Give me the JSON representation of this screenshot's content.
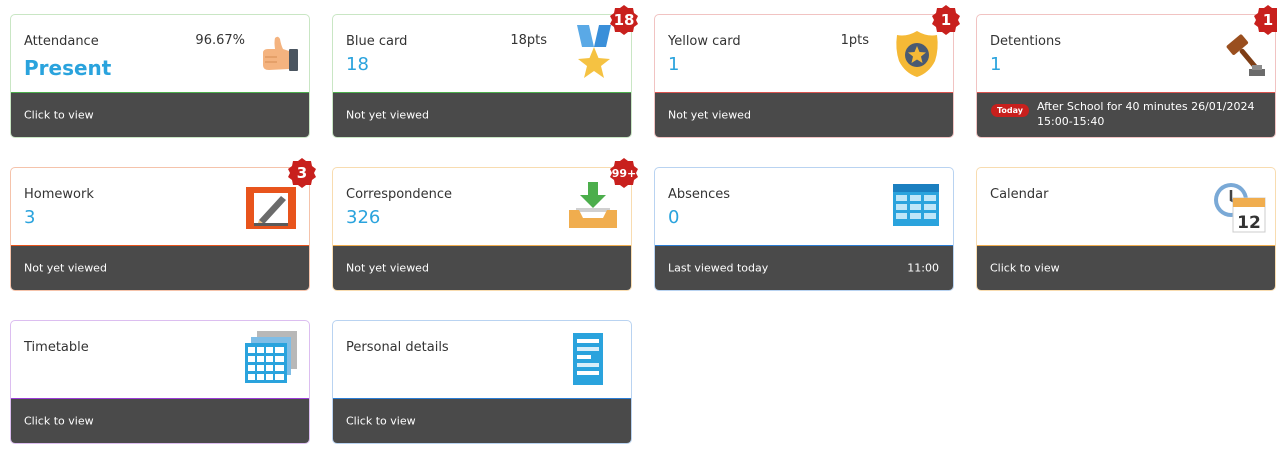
{
  "colors": {
    "bar_dark": "#4a4a4a",
    "stat_blue": "#2aa3dd",
    "badge_red": "#c8201d"
  },
  "tiles": {
    "attendance": {
      "title": "Attendance",
      "stat": "Present",
      "aux": "96.67%",
      "footer": "Click to view",
      "icon": "thumbs-up-icon",
      "accent": "#4cae4c"
    },
    "bluecard": {
      "title": "Blue card",
      "stat": "18",
      "aux": "18pts",
      "footer": "Not yet viewed",
      "badge": "18",
      "icon": "medal-icon",
      "accent": "#4cae4c"
    },
    "yellowcard": {
      "title": "Yellow card",
      "stat": "1",
      "aux": "1pts",
      "footer": "Not yet viewed",
      "badge": "1",
      "icon": "police-badge-icon",
      "accent": "#d9534f"
    },
    "detentions": {
      "title": "Detentions",
      "stat": "1",
      "footer_tag": "Today",
      "footer": "After School for 40 minutes 26/01/2024 15:00-15:40",
      "badge": "1",
      "icon": "gavel-icon",
      "accent": "#d9534f"
    },
    "homework": {
      "title": "Homework",
      "stat": "3",
      "footer": "Not yet viewed",
      "badge": "3",
      "icon": "homework-icon",
      "accent": "#e8541c"
    },
    "correspondence": {
      "title": "Correspondence",
      "stat": "326",
      "footer": "Not yet viewed",
      "badge": "99+",
      "icon": "inbox-icon",
      "accent": "#f0ad4e"
    },
    "absences": {
      "title": "Absences",
      "stat": "0",
      "footer": "Last viewed today",
      "footer_time": "11:00",
      "icon": "table-icon",
      "accent": "#2b7dd4"
    },
    "calendar": {
      "title": "Calendar",
      "footer": "Click to view",
      "icon": "calendar-clock-icon",
      "calendar_day": "12",
      "accent": "#f0ad4e"
    },
    "timetable": {
      "title": "Timetable",
      "footer": "Click to view",
      "icon": "timetable-icon",
      "accent": "#9b3dd6"
    },
    "personal": {
      "title": "Personal details",
      "footer": "Click to view",
      "icon": "document-icon",
      "accent": "#2b7dd4"
    }
  }
}
